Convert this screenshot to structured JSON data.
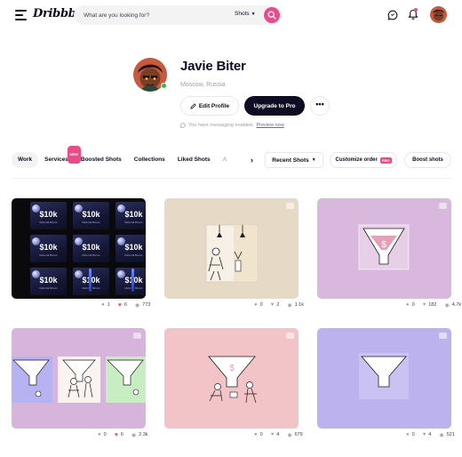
{
  "brand": {
    "logo": "Dribbble",
    "accent_color": "#ea4c89"
  },
  "search": {
    "placeholder": "What are you looking for?",
    "filter_label": "Shots"
  },
  "header_icons": [
    "hamburger-icon",
    "message-icon",
    "bell-icon",
    "search-icon"
  ],
  "profile": {
    "name": "Javie Biter",
    "location": "Moscow, Russia",
    "edit_label": "Edit Profile",
    "upgrade_label": "Upgrade to Pro",
    "more_label": "•••",
    "messaging_note": "You have messaging enabled.",
    "messaging_link": "Preview now"
  },
  "tabs": [
    {
      "label": "Work",
      "active": true
    },
    {
      "label": "Services",
      "badge": "NEW"
    },
    {
      "label": "Boosted Shots"
    },
    {
      "label": "Collections"
    },
    {
      "label": "Liked Shots"
    },
    {
      "label": "A"
    }
  ],
  "controls": {
    "sort_label": "Recent Shots",
    "customize_label": "Customize order",
    "customize_badge": "PRO",
    "boost_label": "Boost shots"
  },
  "shots": [
    {
      "comments": "1",
      "likes": "6",
      "views": "773",
      "liked": true,
      "tiles": [
        {
          "big": "$10k",
          "small": "Referral Bonus"
        },
        {
          "big": "$10k",
          "small": "Referral Bonus"
        },
        {
          "big": "$10k",
          "small": "Referral Bonus"
        },
        {
          "big": "$10k",
          "small": "Referral Bonus"
        },
        {
          "big": "$10k",
          "small": "Referral Bonus"
        },
        {
          "big": "$10k",
          "small": "Referral Bonus"
        },
        {
          "big": "$10k",
          "small": "Referral Bonus"
        },
        {
          "big": "$10k",
          "small": "Referral Bonus"
        },
        {
          "big": "$10k",
          "small": "Referral Bonus"
        }
      ]
    },
    {
      "comments": "0",
      "likes": "2",
      "views": "1.1k",
      "liked": false
    },
    {
      "comments": "0",
      "likes": "182",
      "views": "4.7k",
      "liked": false
    },
    {
      "comments": "0",
      "likes": "6",
      "views": "2.3k",
      "liked": true
    },
    {
      "comments": "0",
      "likes": "4",
      "views": "679",
      "liked": false
    },
    {
      "comments": "0",
      "likes": "4",
      "views": "521",
      "liked": false
    }
  ]
}
